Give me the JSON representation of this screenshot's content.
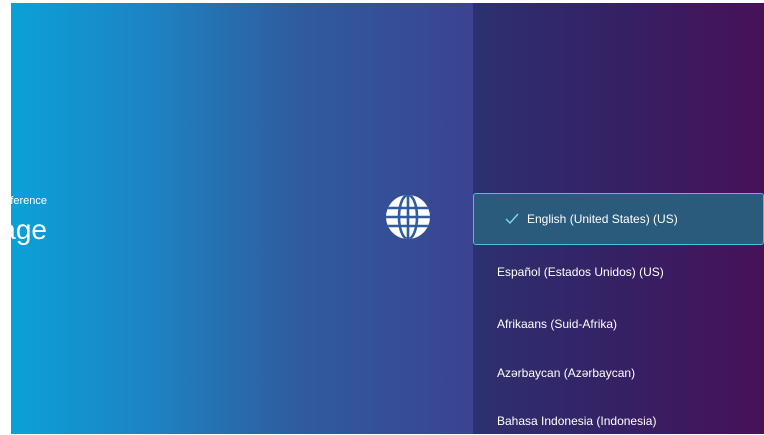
{
  "header": {
    "section_label": "Preference",
    "title": "Language"
  },
  "icons": {
    "section_icon": "globe-icon",
    "selected_icon": "checkmark-icon"
  },
  "colors": {
    "left_gradient_start": "#0ba1d8",
    "left_gradient_end": "#3b4390",
    "right_gradient_start": "#2c316f",
    "right_gradient_end": "#471159",
    "selection_border": "#3fc4e6",
    "selection_fill": "#2a5a7c"
  },
  "languages": [
    {
      "label": "English (United States) (US)",
      "selected": true
    },
    {
      "label": "Español (Estados Unidos) (US)",
      "selected": false
    },
    {
      "label": "Afrikaans (Suid-Afrika)",
      "selected": false
    },
    {
      "label": "Azərbaycan (Azərbaycan)",
      "selected": false
    },
    {
      "label": "Bahasa Indonesia (Indonesia)",
      "selected": false
    }
  ]
}
